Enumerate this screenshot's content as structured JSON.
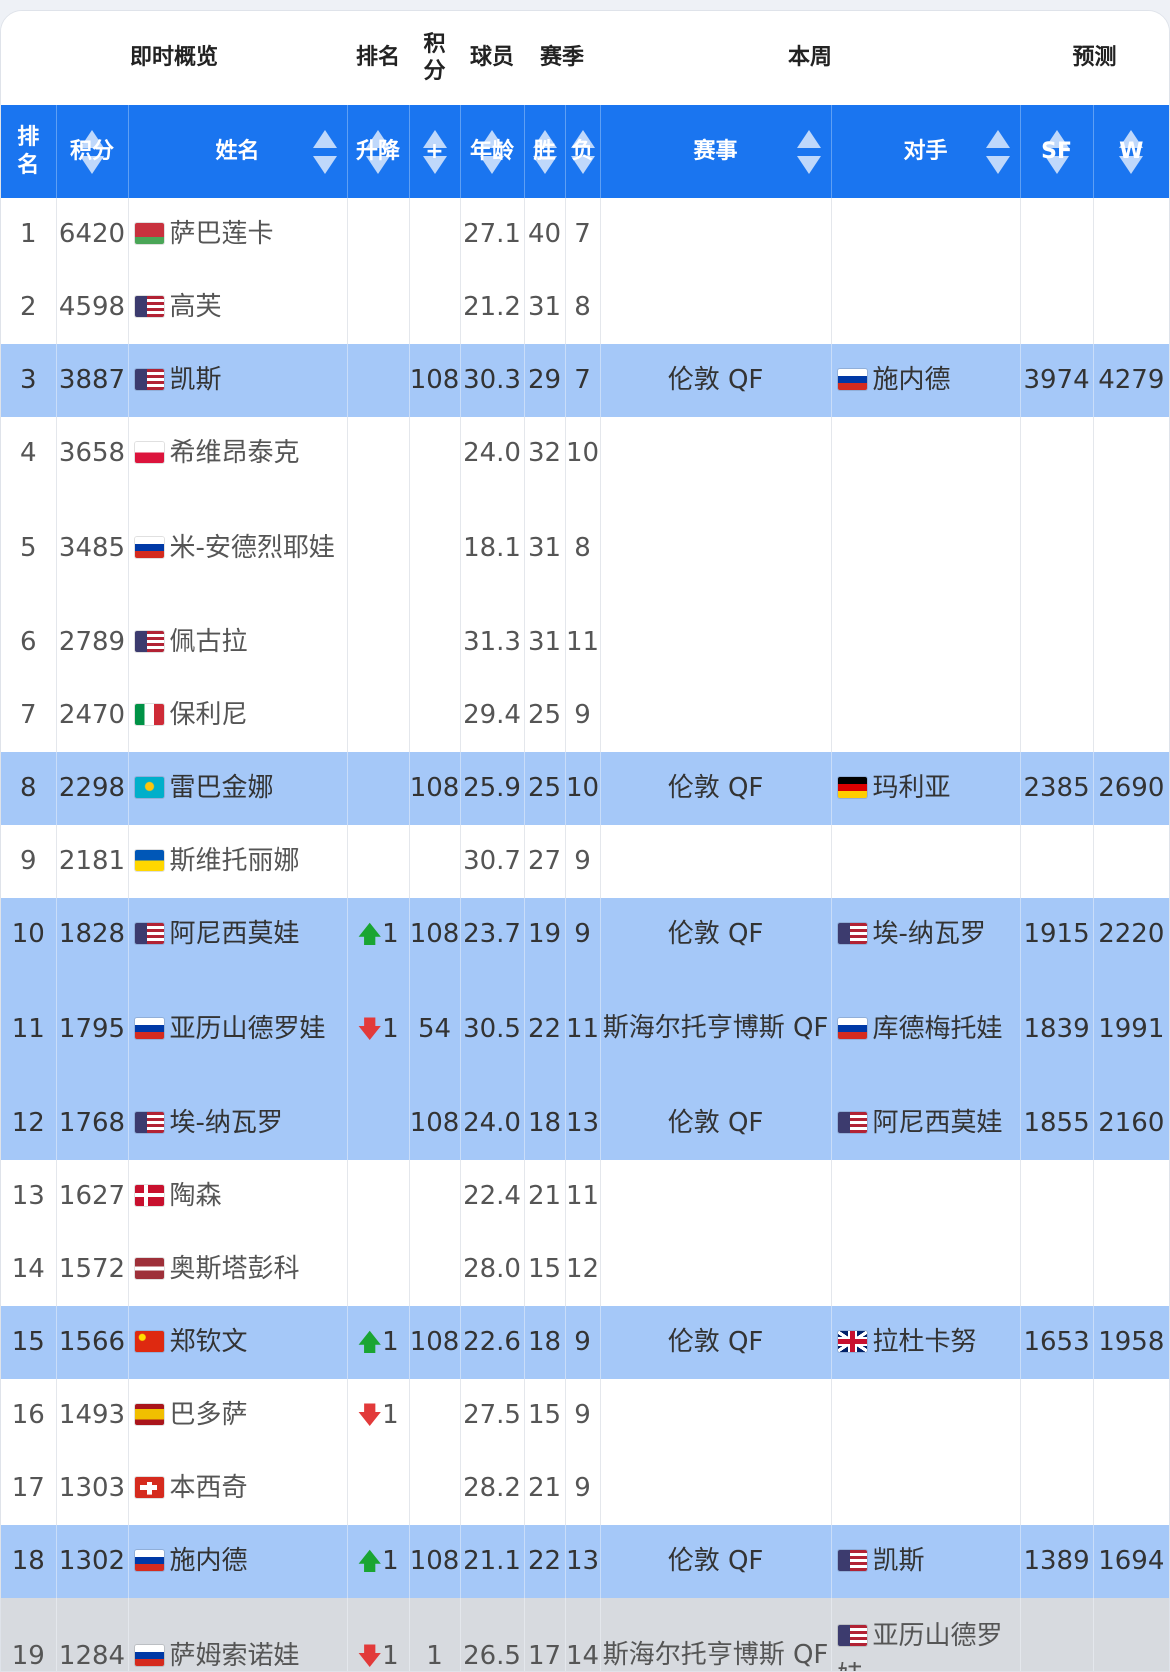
{
  "group_header": {
    "overview": "即时概览",
    "rank": "排名",
    "points": "积\n分",
    "player": "球员",
    "season": "赛季",
    "week": "本周",
    "predict": "预测"
  },
  "columns": [
    "排\n名",
    "积分",
    "姓名",
    "升降",
    "+",
    "年龄",
    "胜",
    "负",
    "赛事",
    "对手",
    "SF",
    "W"
  ],
  "rows": [
    {
      "rank": "1",
      "points": "6420",
      "flag": "by",
      "name": "萨巴莲卡",
      "move": "",
      "dir": "",
      "plus": "",
      "age": "27.1",
      "w": "40",
      "l": "7",
      "event": "",
      "opp": "",
      "oppflag": "",
      "sf": "",
      "wp": "",
      "style": "plain"
    },
    {
      "rank": "2",
      "points": "4598",
      "flag": "us",
      "name": "高芙",
      "move": "",
      "dir": "",
      "plus": "",
      "age": "21.2",
      "w": "31",
      "l": "8",
      "event": "",
      "opp": "",
      "oppflag": "",
      "sf": "",
      "wp": "",
      "style": "plain"
    },
    {
      "rank": "3",
      "points": "3887",
      "flag": "us",
      "name": "凯斯",
      "move": "",
      "dir": "",
      "plus": "108",
      "age": "30.3",
      "w": "29",
      "l": "7",
      "event": "伦敦 QF",
      "opp": "施内德",
      "oppflag": "ru",
      "sf": "3974",
      "wp": "4279",
      "style": "hl"
    },
    {
      "rank": "4",
      "points": "3658",
      "flag": "pl",
      "name": "希维昂泰克",
      "move": "",
      "dir": "",
      "plus": "",
      "age": "24.0",
      "w": "32",
      "l": "10",
      "event": "",
      "opp": "",
      "oppflag": "",
      "sf": "",
      "wp": "",
      "style": "plain"
    },
    {
      "rank": "5",
      "points": "3485",
      "flag": "ru",
      "name": "米-安德烈耶娃",
      "move": "",
      "dir": "",
      "plus": "",
      "age": "18.1",
      "w": "31",
      "l": "8",
      "event": "",
      "opp": "",
      "oppflag": "",
      "sf": "",
      "wp": "",
      "style": "plain",
      "tall": true
    },
    {
      "rank": "6",
      "points": "2789",
      "flag": "us",
      "name": "佩古拉",
      "move": "",
      "dir": "",
      "plus": "",
      "age": "31.3",
      "w": "31",
      "l": "11",
      "event": "",
      "opp": "",
      "oppflag": "",
      "sf": "",
      "wp": "",
      "style": "plain"
    },
    {
      "rank": "7",
      "points": "2470",
      "flag": "it",
      "name": "保利尼",
      "move": "",
      "dir": "",
      "plus": "",
      "age": "29.4",
      "w": "25",
      "l": "9",
      "event": "",
      "opp": "",
      "oppflag": "",
      "sf": "",
      "wp": "",
      "style": "plain"
    },
    {
      "rank": "8",
      "points": "2298",
      "flag": "kz",
      "name": "雷巴金娜",
      "move": "",
      "dir": "",
      "plus": "108",
      "age": "25.9",
      "w": "25",
      "l": "10",
      "event": "伦敦 QF",
      "opp": "玛利亚",
      "oppflag": "de",
      "sf": "2385",
      "wp": "2690",
      "style": "hl"
    },
    {
      "rank": "9",
      "points": "2181",
      "flag": "ua",
      "name": "斯维托丽娜",
      "move": "",
      "dir": "",
      "plus": "",
      "age": "30.7",
      "w": "27",
      "l": "9",
      "event": "",
      "opp": "",
      "oppflag": "",
      "sf": "",
      "wp": "",
      "style": "plain"
    },
    {
      "rank": "10",
      "points": "1828",
      "flag": "us",
      "name": "阿尼西莫娃",
      "move": "1",
      "dir": "up",
      "plus": "108",
      "age": "23.7",
      "w": "19",
      "l": "9",
      "event": "伦敦 QF",
      "opp": "埃-纳瓦罗",
      "oppflag": "us",
      "sf": "1915",
      "wp": "2220",
      "style": "hl"
    },
    {
      "rank": "11",
      "points": "1795",
      "flag": "ru",
      "name": "亚历山德罗娃",
      "move": "1",
      "dir": "down",
      "plus": "54",
      "age": "30.5",
      "w": "22",
      "l": "11",
      "event": "斯海尔托亨博斯 QF",
      "opp": "库德梅托娃",
      "oppflag": "ru",
      "sf": "1839",
      "wp": "1991",
      "style": "hl",
      "tall": true
    },
    {
      "rank": "12",
      "points": "1768",
      "flag": "us",
      "name": "埃-纳瓦罗",
      "move": "",
      "dir": "",
      "plus": "108",
      "age": "24.0",
      "w": "18",
      "l": "13",
      "event": "伦敦 QF",
      "opp": "阿尼西莫娃",
      "oppflag": "us",
      "sf": "1855",
      "wp": "2160",
      "style": "hl"
    },
    {
      "rank": "13",
      "points": "1627",
      "flag": "dk",
      "name": "陶森",
      "move": "",
      "dir": "",
      "plus": "",
      "age": "22.4",
      "w": "21",
      "l": "11",
      "event": "",
      "opp": "",
      "oppflag": "",
      "sf": "",
      "wp": "",
      "style": "plain"
    },
    {
      "rank": "14",
      "points": "1572",
      "flag": "lv",
      "name": "奥斯塔彭科",
      "move": "",
      "dir": "",
      "plus": "",
      "age": "28.0",
      "w": "15",
      "l": "12",
      "event": "",
      "opp": "",
      "oppflag": "",
      "sf": "",
      "wp": "",
      "style": "plain"
    },
    {
      "rank": "15",
      "points": "1566",
      "flag": "cn",
      "name": "郑钦文",
      "move": "1",
      "dir": "up",
      "plus": "108",
      "age": "22.6",
      "w": "18",
      "l": "9",
      "event": "伦敦 QF",
      "opp": "拉杜卡努",
      "oppflag": "gb",
      "sf": "1653",
      "wp": "1958",
      "style": "hl"
    },
    {
      "rank": "16",
      "points": "1493",
      "flag": "es",
      "name": "巴多萨",
      "move": "1",
      "dir": "down",
      "plus": "",
      "age": "27.5",
      "w": "15",
      "l": "9",
      "event": "",
      "opp": "",
      "oppflag": "",
      "sf": "",
      "wp": "",
      "style": "plain"
    },
    {
      "rank": "17",
      "points": "1303",
      "flag": "ch",
      "name": "本西奇",
      "move": "",
      "dir": "",
      "plus": "",
      "age": "28.2",
      "w": "21",
      "l": "9",
      "event": "",
      "opp": "",
      "oppflag": "",
      "sf": "",
      "wp": "",
      "style": "plain"
    },
    {
      "rank": "18",
      "points": "1302",
      "flag": "ru",
      "name": "施内德",
      "move": "1",
      "dir": "up",
      "plus": "108",
      "age": "21.1",
      "w": "22",
      "l": "13",
      "event": "伦敦 QF",
      "opp": "凯斯",
      "oppflag": "us",
      "sf": "1389",
      "wp": "1694",
      "style": "hl"
    },
    {
      "rank": "19",
      "points": "1284",
      "flag": "ru",
      "name": "萨姆索诺娃",
      "move": "1",
      "dir": "down",
      "plus": "1",
      "age": "26.5",
      "w": "17",
      "l": "14",
      "event": "斯海尔托亨博斯 QF",
      "opp": "亚历山德罗娃",
      "oppflag": "us",
      "sf": "",
      "wp": "",
      "style": "gr",
      "tall": true
    }
  ]
}
